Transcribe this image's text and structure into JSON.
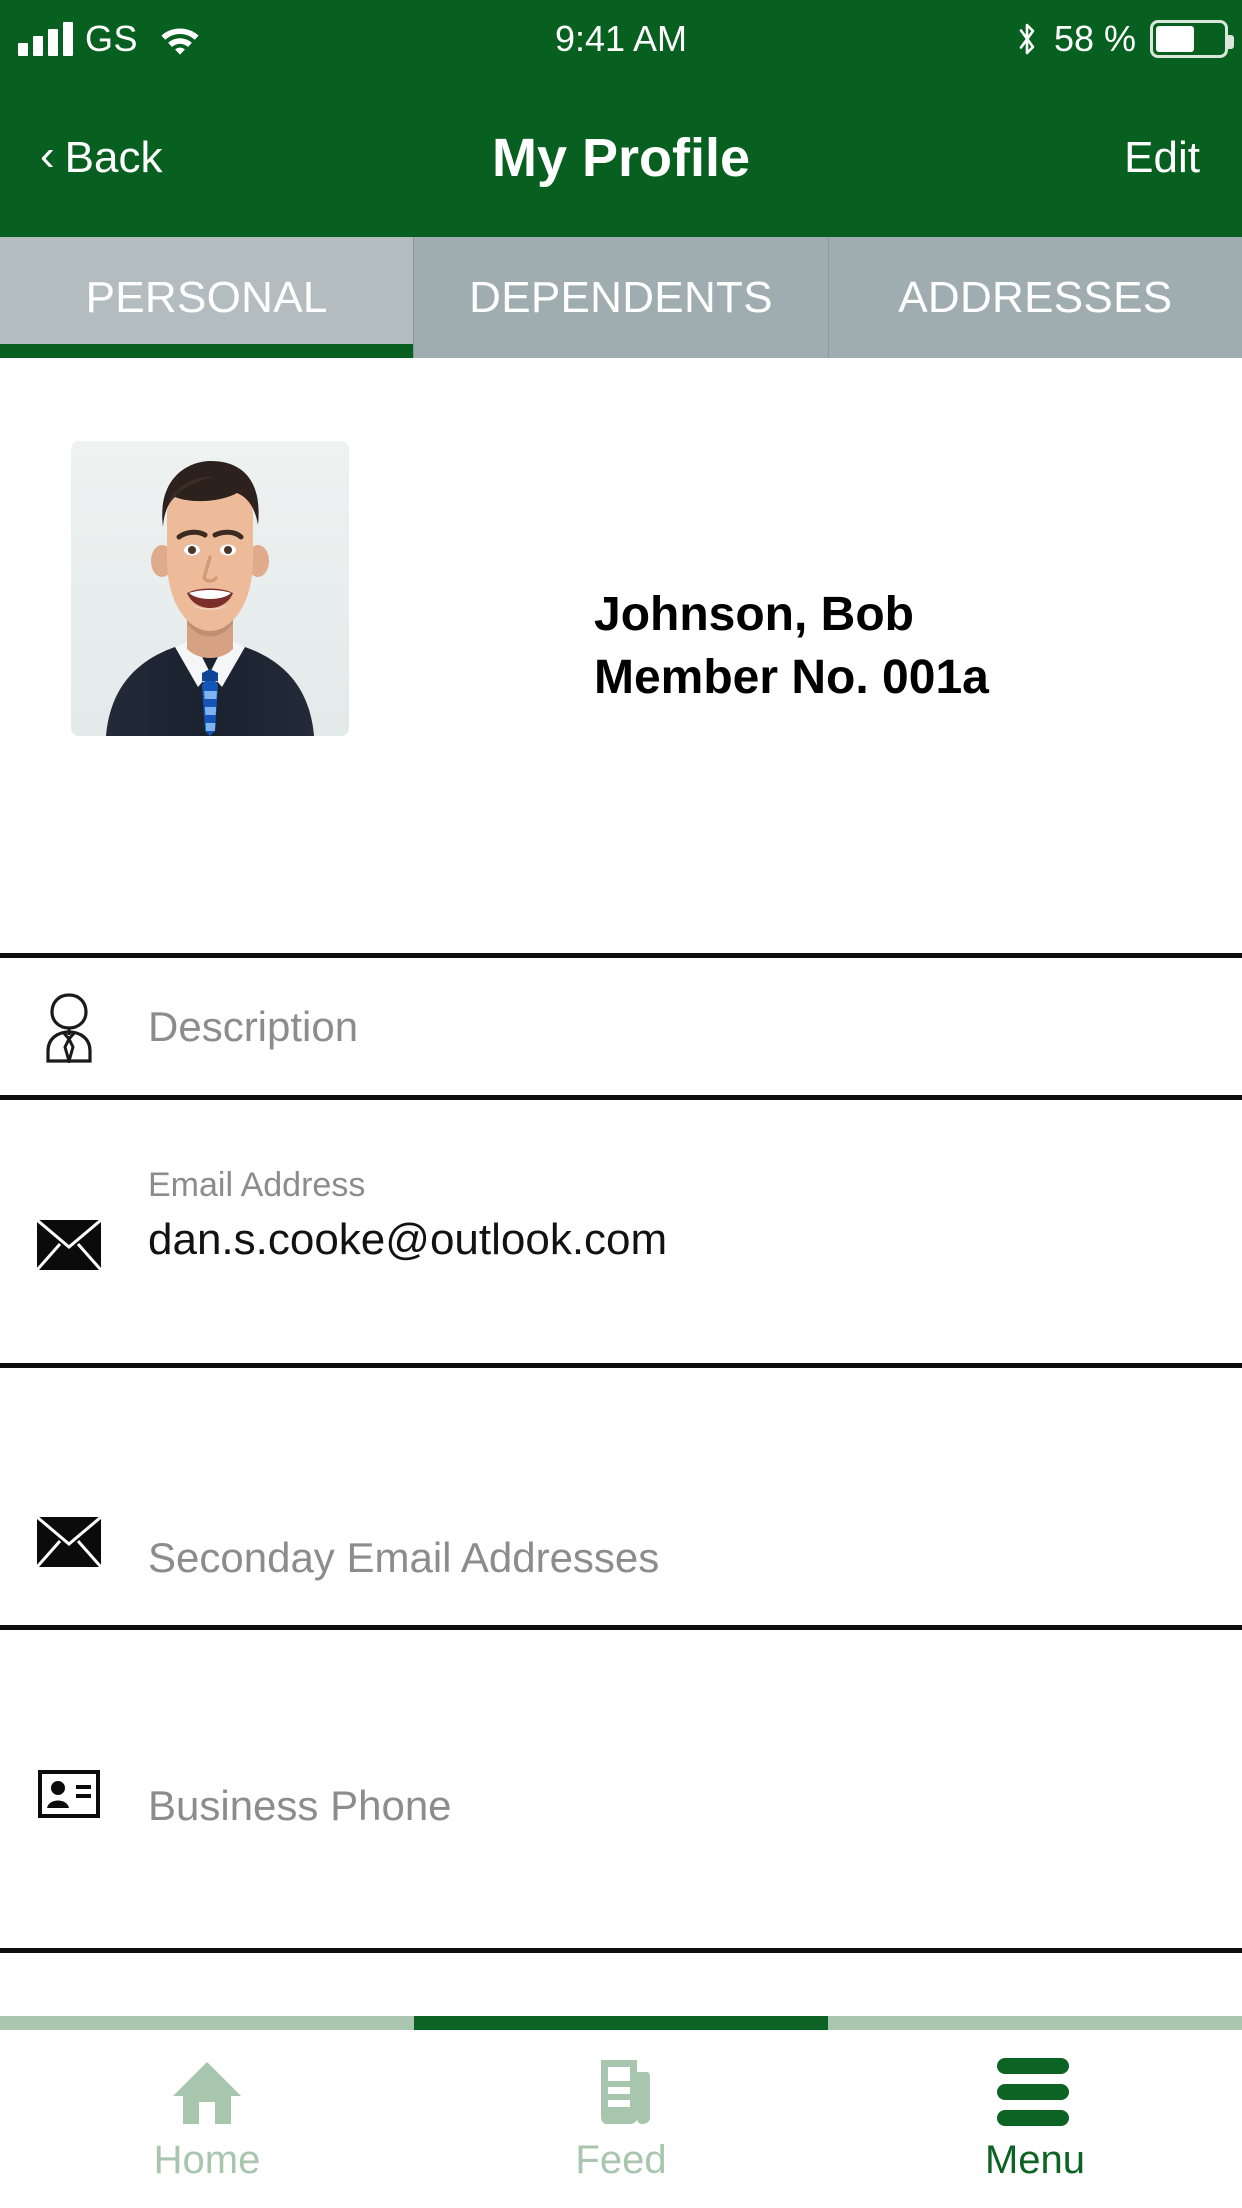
{
  "status_bar": {
    "carrier": "GS",
    "time": "9:41 AM",
    "battery_percent": "58 %",
    "battery_level": 58,
    "icons": [
      "signal-bars-icon",
      "wifi-icon",
      "bluetooth-icon",
      "battery-icon"
    ]
  },
  "nav": {
    "back_label": "Back",
    "back_chevron": "‹",
    "title": "My Profile",
    "edit_label": "Edit"
  },
  "tabs": {
    "items": [
      {
        "label": "PERSONAL",
        "active": true
      },
      {
        "label": "DEPENDENTS",
        "active": false
      },
      {
        "label": "ADDRESSES",
        "active": false
      }
    ]
  },
  "profile": {
    "photo_alt": "profile-photo",
    "name": "Johnson, Bob",
    "member_no": "Member No. 001a"
  },
  "fields": [
    {
      "icon": "person-tie-icon",
      "placeholder": "Description",
      "label": "",
      "value": ""
    },
    {
      "icon": "envelope-icon",
      "placeholder": "",
      "label": "Email Address",
      "value": "dan.s.cooke@outlook.com"
    },
    {
      "icon": "envelope-icon",
      "placeholder": "Seconday Email Addresses",
      "label": "",
      "value": ""
    },
    {
      "icon": "contact-card-icon",
      "placeholder": "Business Phone",
      "label": "",
      "value": ""
    }
  ],
  "bottom_bar": {
    "items": [
      {
        "label": "Home",
        "icon": "home-icon",
        "active": false
      },
      {
        "label": "Feed",
        "icon": "feed-icon",
        "active": false
      },
      {
        "label": "Menu",
        "icon": "hamburger-icon",
        "active": true
      }
    ]
  },
  "colors": {
    "brand_green": "#07601f",
    "accent_green": "#0c6323",
    "tab_gray": "#9fadb0",
    "tab_gray_active": "#b3bdbf",
    "muted_green": "#a8c6ad",
    "placeholder_gray": "#8c8c8c"
  }
}
